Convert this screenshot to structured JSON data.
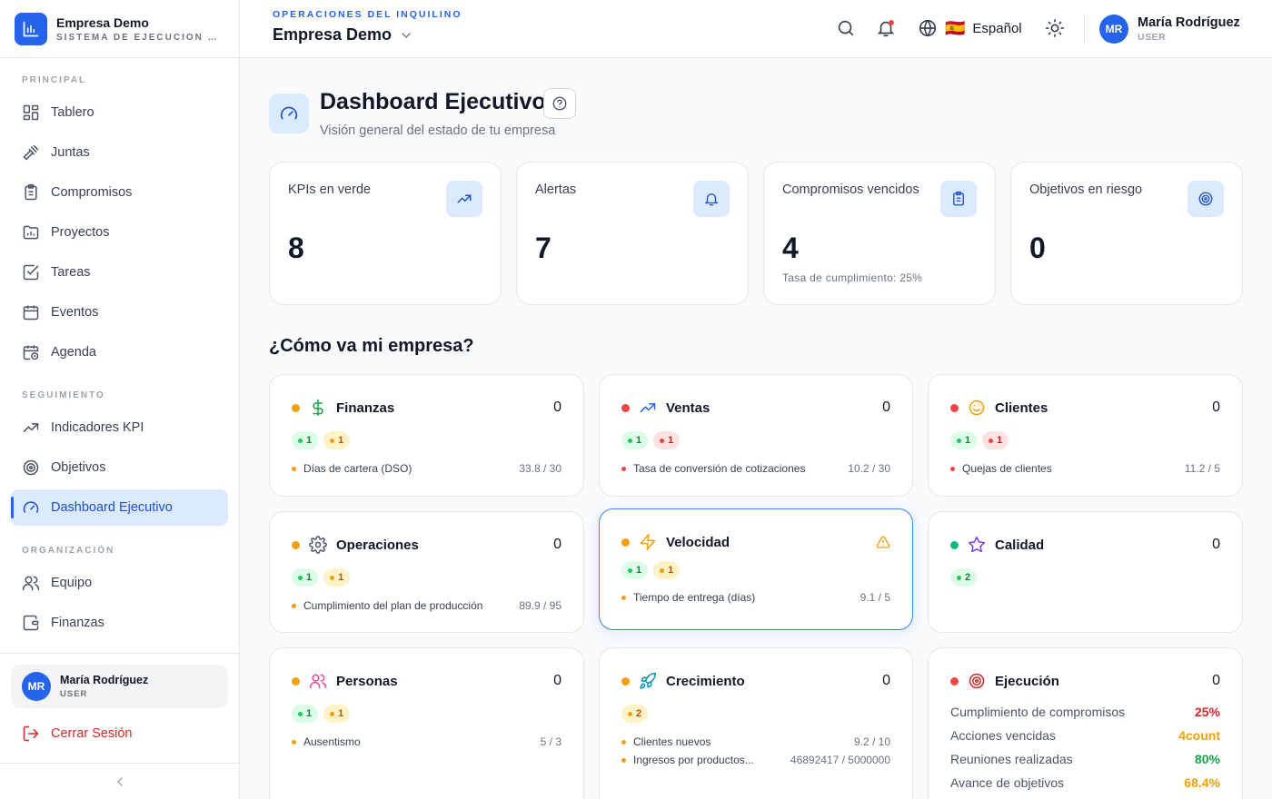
{
  "brand": {
    "name": "Empresa Demo",
    "subtitle": "SISTEMA DE EJECUCIÓN E..."
  },
  "sidebar": {
    "sections": [
      "PRINCIPAL",
      "SEGUIMIENTO",
      "ORGANIZACIÓN"
    ],
    "items": [
      {
        "label": "Tablero",
        "icon": "grid-icon"
      },
      {
        "label": "Juntas",
        "icon": "gavel-icon"
      },
      {
        "label": "Compromisos",
        "icon": "clipboard-icon"
      },
      {
        "label": "Proyectos",
        "icon": "folder-icon"
      },
      {
        "label": "Tareas",
        "icon": "checkbox-icon"
      },
      {
        "label": "Eventos",
        "icon": "calendar-icon"
      },
      {
        "label": "Agenda",
        "icon": "calendar-clock-icon"
      },
      {
        "label": "Indicadores KPI",
        "icon": "trending-up-icon"
      },
      {
        "label": "Objetivos",
        "icon": "target-icon"
      },
      {
        "label": "Dashboard Ejecutivo",
        "icon": "gauge-icon"
      },
      {
        "label": "Equipo",
        "icon": "users-icon"
      },
      {
        "label": "Finanzas",
        "icon": "wallet-icon"
      }
    ],
    "user": {
      "initials": "MR",
      "name": "María Rodríguez",
      "role": "USER"
    },
    "logout": "Cerrar Sesión",
    "collapse_icon": "chevron-left-icon"
  },
  "header": {
    "tenant_label": "OPERACIONES DEL INQUILINO",
    "tenant_name": "Empresa Demo",
    "language": "Español",
    "flag": "🇪🇸",
    "user": {
      "initials": "MR",
      "name": "María Rodríguez",
      "role": "USER"
    }
  },
  "page": {
    "title": "Dashboard Ejecutivo",
    "subtitle": "Visión general del estado de tu empresa",
    "section_title": "¿Cómo va mi empresa?"
  },
  "kpis": [
    {
      "title": "KPIs en verde",
      "value": "8",
      "sub": "",
      "icon": "trending-up-icon"
    },
    {
      "title": "Alertas",
      "value": "7",
      "sub": "",
      "icon": "bell-icon"
    },
    {
      "title": "Compromisos vencidos",
      "value": "4",
      "sub": "Tasa de cumplimiento: 25%",
      "icon": "clipboard-icon"
    },
    {
      "title": "Objetivos en riesgo",
      "value": "0",
      "sub": "",
      "icon": "target-icon"
    }
  ],
  "areas": [
    {
      "name": "Finanzas",
      "count": "0",
      "status": "#f59e0b",
      "icon": "dollar-icon",
      "icon_color": "#16a34a",
      "pills": [
        {
          "type": "g",
          "n": "1"
        },
        {
          "type": "y",
          "n": "1"
        }
      ],
      "metrics": [
        {
          "name": "Días de cartera (DSO)",
          "value": "33.8  /  30",
          "dot": "#f59e0b"
        }
      ]
    },
    {
      "name": "Ventas",
      "count": "0",
      "status": "#ef4444",
      "icon": "trending-up-icon",
      "icon_color": "#2563eb",
      "pills": [
        {
          "type": "g",
          "n": "1"
        },
        {
          "type": "r",
          "n": "1"
        }
      ],
      "metrics": [
        {
          "name": "Tasa de conversión de cotizaciones",
          "value": "10.2  /  30",
          "dot": "#ef4444"
        }
      ]
    },
    {
      "name": "Clientes",
      "count": "0",
      "status": "#ef4444",
      "icon": "smile-icon",
      "icon_color": "#f59e0b",
      "pills": [
        {
          "type": "g",
          "n": "1"
        },
        {
          "type": "r",
          "n": "1"
        }
      ],
      "metrics": [
        {
          "name": "Quejas de clientes",
          "value": "11.2  /  5",
          "dot": "#ef4444"
        }
      ]
    },
    {
      "name": "Operaciones",
      "count": "0",
      "status": "#f59e0b",
      "icon": "gear-icon",
      "icon_color": "#4b5563",
      "pills": [
        {
          "type": "g",
          "n": "1"
        },
        {
          "type": "y",
          "n": "1"
        }
      ],
      "metrics": [
        {
          "name": "Cumplimiento del plan de producción",
          "value": "89.9  /  95",
          "dot": "#f59e0b"
        }
      ]
    },
    {
      "name": "Velocidad",
      "count": "",
      "status": "#f59e0b",
      "icon": "lightning-icon",
      "icon_color": "#f59e0b",
      "pills": [
        {
          "type": "g",
          "n": "1"
        },
        {
          "type": "y",
          "n": "1"
        }
      ],
      "metrics": [
        {
          "name": "Tiempo de entrega (días)",
          "value": "9.1  /  5",
          "dot": "#f59e0b"
        }
      ]
    },
    {
      "name": "Calidad",
      "count": "0",
      "status": "#10b981",
      "icon": "star-icon",
      "icon_color": "#7c3aed",
      "pills": [
        {
          "type": "g",
          "n": "2"
        }
      ],
      "metrics": []
    },
    {
      "name": "Personas",
      "count": "0",
      "status": "#f59e0b",
      "icon": "users-icon",
      "icon_color": "#ec4899",
      "pills": [
        {
          "type": "g",
          "n": "1"
        },
        {
          "type": "y",
          "n": "1"
        }
      ],
      "metrics": [
        {
          "name": "Ausentismo",
          "value": "5  /  3",
          "dot": "#f59e0b"
        }
      ]
    },
    {
      "name": "Crecimiento",
      "count": "0",
      "status": "#f59e0b",
      "icon": "rocket-icon",
      "icon_color": "#0891b2",
      "pills": [
        {
          "type": "y",
          "n": "2"
        }
      ],
      "metrics": [
        {
          "name": "Clientes nuevos",
          "value": "9.2  /  10",
          "dot": "#f59e0b"
        },
        {
          "name": "Ingresos por productos...",
          "value": "46892417  /  5000000",
          "dot": "#f59e0b"
        }
      ]
    },
    {
      "name": "Ejecución",
      "count": "0",
      "status": "#ef4444",
      "icon": "target-icon",
      "icon_color": "#dc2626",
      "pills": [],
      "metrics": []
    }
  ],
  "execution": [
    {
      "label": "Cumplimiento de compromisos",
      "value": "25%",
      "color": "#dc2626"
    },
    {
      "label": "Acciones vencidas",
      "value": "4count",
      "color": "#f59e0b"
    },
    {
      "label": "Reuniones realizadas",
      "value": "80%",
      "color": "#16a34a"
    },
    {
      "label": "Avance de objetivos",
      "value": "68.4%",
      "color": "#f59e0b"
    }
  ]
}
